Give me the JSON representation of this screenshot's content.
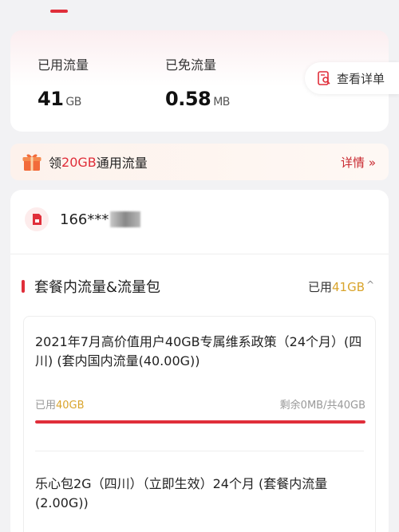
{
  "usage": {
    "used_label": "已用流量",
    "used_value": "41",
    "used_unit": "GB",
    "free_label": "已免流量",
    "free_value": "0.58",
    "free_unit": "MB",
    "detail_label": "查看详单"
  },
  "promo": {
    "prefix": "领",
    "highlight": "20GB",
    "suffix": "通用流量",
    "more_label": "详情 »"
  },
  "phone": {
    "number_visible": "166***"
  },
  "section": {
    "title": "套餐内流量&流量包",
    "used_prefix": "已用",
    "used_value": "41GB",
    "caret": "^"
  },
  "plans": [
    {
      "name": "2021年7月高价值用户40GB专属维系政策（24个月）(四川) (套内国内流量(40.00G))",
      "used_prefix": "已用",
      "used_value": "40GB",
      "remaining": "剩余0MB/共40GB",
      "progress_fraction": 1.0
    },
    {
      "name": "乐心包2G（四川）（立即生效）24个月 (套餐内流量(2.00G))"
    }
  ],
  "colors": {
    "accent_red": "#e02e3a",
    "gold": "#d9a42c"
  }
}
